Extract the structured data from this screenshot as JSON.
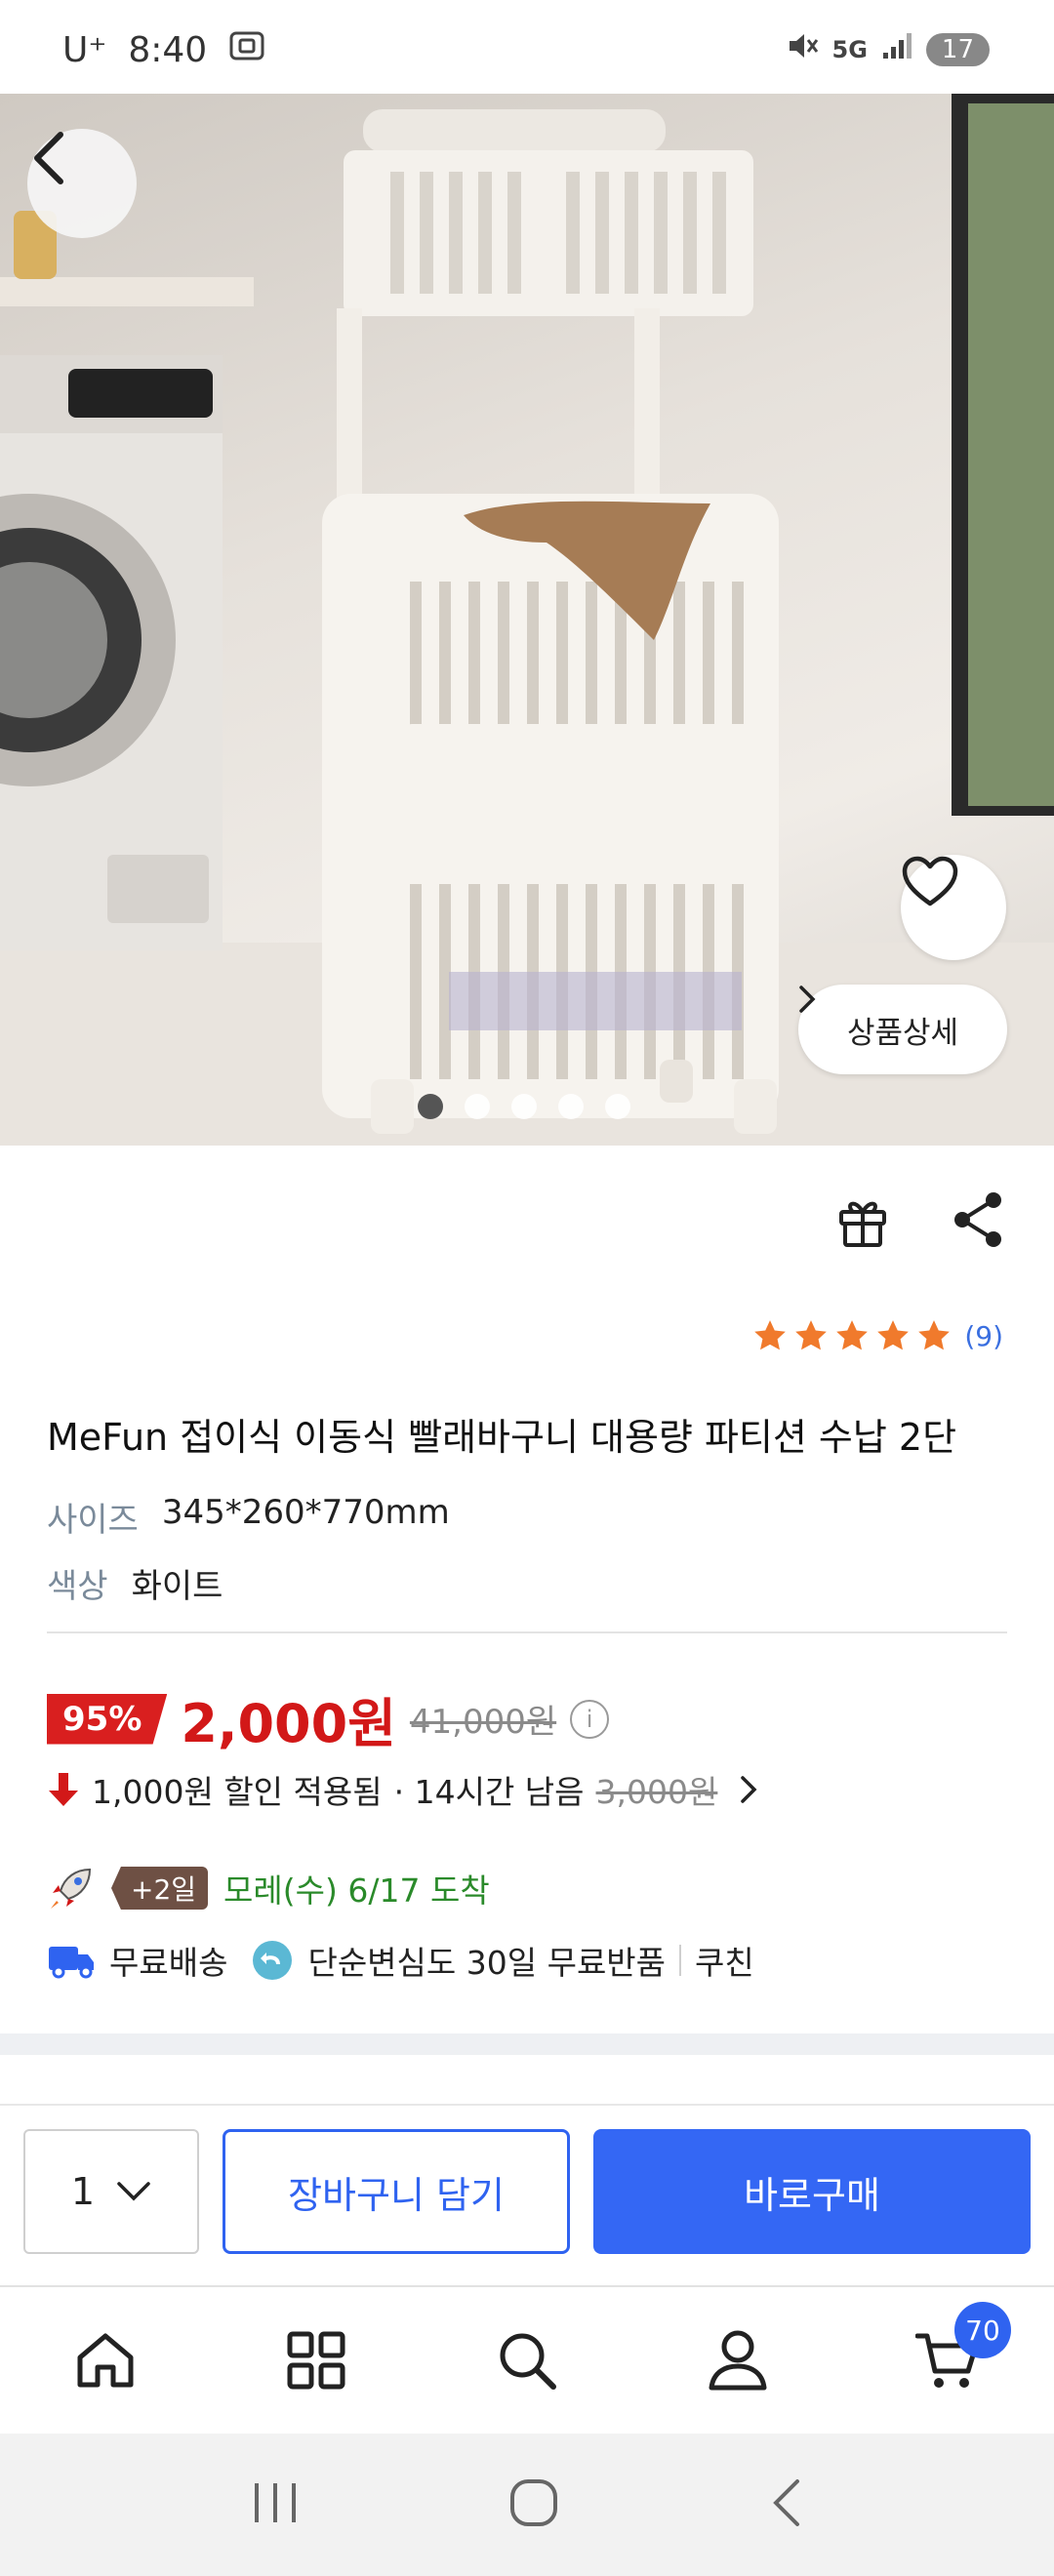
{
  "status_bar": {
    "carrier": "U⁺",
    "time": "8:40",
    "network": "5G",
    "battery": "17"
  },
  "hero": {
    "detail_label": "상품상세",
    "image_count": 5,
    "active_index": 0
  },
  "product": {
    "rating_stars": 5,
    "review_count": "(9)",
    "title": "MeFun 접이식 이동식 빨래바구니 대용량 파티션 수납 2단",
    "options": [
      {
        "key": "사이즈",
        "value": "345*260*770mm"
      },
      {
        "key": "색상",
        "value": "화이트"
      }
    ]
  },
  "pricing": {
    "discount": "95%",
    "price": "2,000원",
    "original_price": "41,000원",
    "coupon_text": "1,000원 할인 적용됨",
    "time_left": "· 14시간 남음",
    "before_coupon": "3,000원"
  },
  "shipping": {
    "extra_days": "+2일",
    "arrival": "모레(수) 6/17 도착",
    "free_shipping": "무료배송",
    "free_return": "단순변심도 30일 무료반품",
    "seller": "쿠친"
  },
  "buy_bar": {
    "quantity": "1",
    "cart_label": "장바구니 담기",
    "buy_label": "바로구매"
  },
  "nav": {
    "cart_count": "70"
  },
  "colors": {
    "accent_blue": "#3467f4",
    "price_red": "#d21818",
    "star_orange": "#f07a2c"
  }
}
